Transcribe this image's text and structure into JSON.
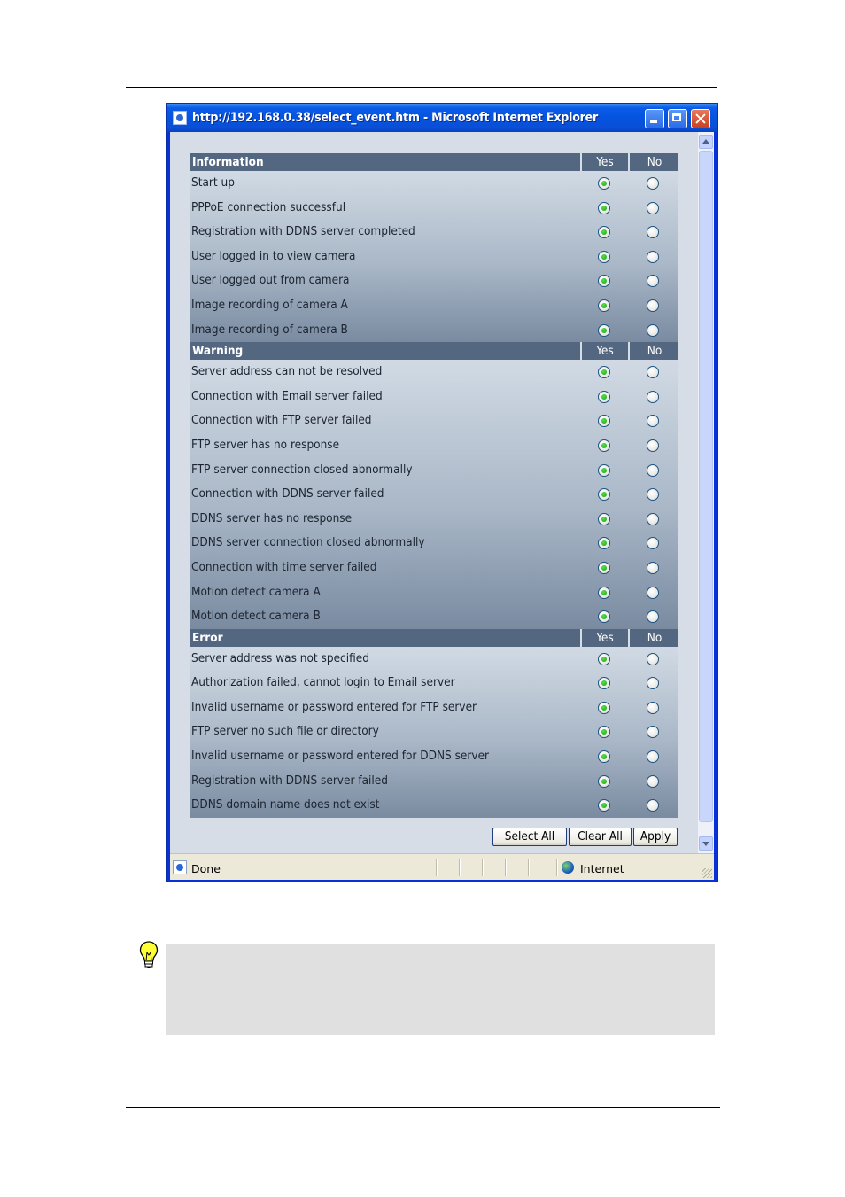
{
  "window": {
    "title": "http://192.168.0.38/select_event.htm - Microsoft Internet Explorer"
  },
  "columns": {
    "yes": "Yes",
    "no": "No"
  },
  "sections": [
    {
      "title": "Information",
      "rows": [
        {
          "label": "Start up",
          "selected": "yes"
        },
        {
          "label": "PPPoE connection successful",
          "selected": "yes"
        },
        {
          "label": "Registration with DDNS server completed",
          "selected": "yes"
        },
        {
          "label": "User logged in to view camera",
          "selected": "yes"
        },
        {
          "label": "User logged out from camera",
          "selected": "yes"
        },
        {
          "label": "Image recording of camera A",
          "selected": "yes"
        },
        {
          "label": "Image recording of camera B",
          "selected": "yes"
        }
      ]
    },
    {
      "title": "Warning",
      "rows": [
        {
          "label": "Server address can not be resolved",
          "selected": "yes"
        },
        {
          "label": "Connection with Email server failed",
          "selected": "yes"
        },
        {
          "label": "Connection with FTP server failed",
          "selected": "yes"
        },
        {
          "label": "FTP server has no response",
          "selected": "yes"
        },
        {
          "label": "FTP server connection closed abnormally",
          "selected": "yes"
        },
        {
          "label": "Connection with DDNS server failed",
          "selected": "yes"
        },
        {
          "label": "DDNS server has no response",
          "selected": "yes"
        },
        {
          "label": "DDNS server connection closed abnormally",
          "selected": "yes"
        },
        {
          "label": "Connection with time server failed",
          "selected": "yes"
        },
        {
          "label": "Motion detect camera A",
          "selected": "yes"
        },
        {
          "label": "Motion detect camera B",
          "selected": "yes"
        }
      ]
    },
    {
      "title": "Error",
      "rows": [
        {
          "label": "Server address was not specified",
          "selected": "yes"
        },
        {
          "label": "Authorization failed, cannot login to Email server",
          "selected": "yes"
        },
        {
          "label": "Invalid username or password entered for FTP server",
          "selected": "yes"
        },
        {
          "label": "FTP server no such file or directory",
          "selected": "yes"
        },
        {
          "label": "Invalid username or password entered for DDNS server",
          "selected": "yes"
        },
        {
          "label": "Registration with DDNS server failed",
          "selected": "yes"
        },
        {
          "label": "DDNS domain name does not exist",
          "selected": "yes"
        }
      ]
    }
  ],
  "buttons": {
    "select_all": "Select All",
    "clear_all": "Clear All",
    "apply": "Apply"
  },
  "statusbar": {
    "status": "Done",
    "zone": "Internet"
  },
  "icons": {
    "title": "ie-page-icon",
    "status": "ie-page-icon",
    "zone": "globe-icon",
    "note": "lightbulb-icon"
  }
}
